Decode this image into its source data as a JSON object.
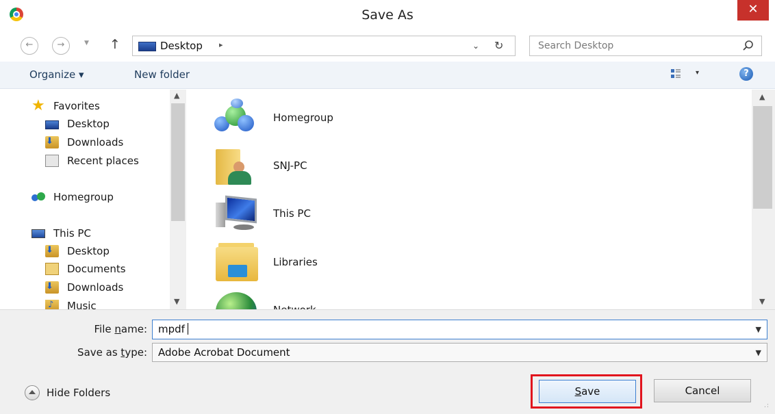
{
  "window": {
    "title": "Save As",
    "close_label": "✕"
  },
  "address": {
    "location": "Desktop",
    "separator": "▸",
    "dropdown": "⌄",
    "refresh": "↻",
    "search_placeholder": "Search Desktop"
  },
  "toolbar": {
    "organize_label": "Organize ▾",
    "new_folder_label": "New folder",
    "view_dropdown": "▾",
    "help": "?"
  },
  "navigation": {
    "items": [
      {
        "label": "Favorites",
        "icon": "star-icon"
      },
      {
        "label": "Desktop",
        "icon": "desktop-icon"
      },
      {
        "label": "Downloads",
        "icon": "downloads-icon"
      },
      {
        "label": "Recent places",
        "icon": "recent-places-icon"
      },
      {
        "label": "Homegroup",
        "icon": "homegroup-icon"
      },
      {
        "label": "This PC",
        "icon": "this-pc-icon"
      },
      {
        "label": "Desktop",
        "icon": "desktop-icon"
      },
      {
        "label": "Documents",
        "icon": "documents-icon"
      },
      {
        "label": "Downloads",
        "icon": "downloads-icon"
      },
      {
        "label": "Music",
        "icon": "music-icon"
      }
    ]
  },
  "files": {
    "items": [
      {
        "label": "Homegroup",
        "icon": "homegroup-icon"
      },
      {
        "label": "SNJ-PC",
        "icon": "user-folder-icon"
      },
      {
        "label": "This PC",
        "icon": "computer-icon"
      },
      {
        "label": "Libraries",
        "icon": "libraries-icon"
      },
      {
        "label": "Network",
        "icon": "network-icon"
      }
    ]
  },
  "form": {
    "file_name_label_pre": "File ",
    "file_name_label_u": "n",
    "file_name_label_post": "ame:",
    "file_name_value": "mpdf",
    "save_type_label_pre": "Save as ",
    "save_type_label_u": "t",
    "save_type_label_post": "ype:",
    "save_type_value": "Adobe Acrobat Document"
  },
  "footer": {
    "hide_folders_label": "Hide Folders",
    "save_label_u": "S",
    "save_label_rest": "ave",
    "cancel_label": "Cancel"
  },
  "colors": {
    "highlight_box": "#e1141d",
    "close_button": "#c7312b",
    "toolbar_bg": "#f0f4f9"
  }
}
